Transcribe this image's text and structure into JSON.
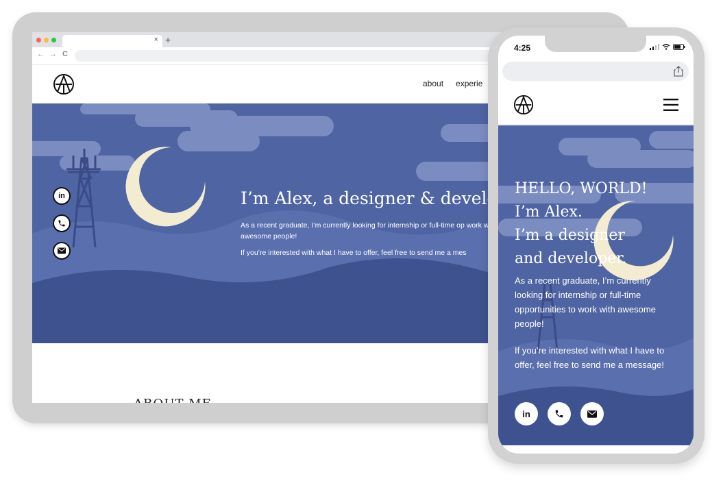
{
  "colors": {
    "hero_bg": "#4f64a2",
    "cloud": "#7b8cc0",
    "hill_light": "#5a6fae",
    "hill_dark": "#3e5290",
    "moon": "#f3ecd1",
    "tower": "#3a4b88",
    "frame": "#cfcfcf"
  },
  "browser": {
    "tab_close": "×",
    "new_tab": "+",
    "back": "←",
    "forward": "→",
    "reload": "C"
  },
  "desktop": {
    "nav": [
      "about",
      "experie"
    ],
    "hero_title": "I’m Alex, a designer & develo",
    "hero_p1": "As a recent graduate, I’m currently looking for internship or full-time op work with awesome people!",
    "hero_p2": "If you’re interested with what I have to offer, feel free to send me a mes",
    "social": [
      "in",
      "phone-icon",
      "mail-icon"
    ],
    "about_heading": "ABOUT ME"
  },
  "mobile": {
    "time": "4:25",
    "hero_heading": "HELLO, WORLD!\nI’m Alex.\nI’m a designer\nand developer.",
    "hero_p1": "As a recent graduate, I’m currently looking for internship or full-time opportunities to work with awesome people!",
    "hero_p2": "If you’re interested with what I have to offer, feel free to send me a message!",
    "social": [
      "in",
      "phone-icon",
      "mail-icon"
    ]
  }
}
